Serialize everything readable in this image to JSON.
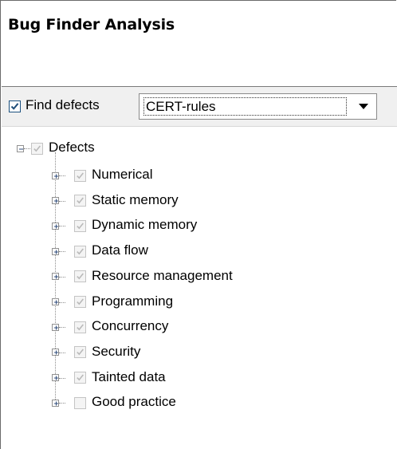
{
  "panel": {
    "title": "Bug Finder Analysis"
  },
  "toolbar": {
    "find_defects_label": "Find defects",
    "find_defects_checked": true,
    "rule_set_value": "CERT-rules"
  },
  "tree": {
    "root": {
      "label": "Defects",
      "checked": true,
      "expanded": true
    },
    "children": [
      {
        "label": "Numerical",
        "checked": true
      },
      {
        "label": "Static memory",
        "checked": true
      },
      {
        "label": "Dynamic memory",
        "checked": true
      },
      {
        "label": "Data flow",
        "checked": true
      },
      {
        "label": "Resource management",
        "checked": true
      },
      {
        "label": "Programming",
        "checked": true
      },
      {
        "label": "Concurrency",
        "checked": true
      },
      {
        "label": "Security",
        "checked": true
      },
      {
        "label": "Tainted data",
        "checked": true
      },
      {
        "label": "Good practice",
        "checked": false
      }
    ]
  },
  "colors": {
    "toolbar_bg": "#f0f0f0",
    "check_mark_active": "#1f4e7a",
    "check_mark_disabled": "#b9b9b9"
  }
}
